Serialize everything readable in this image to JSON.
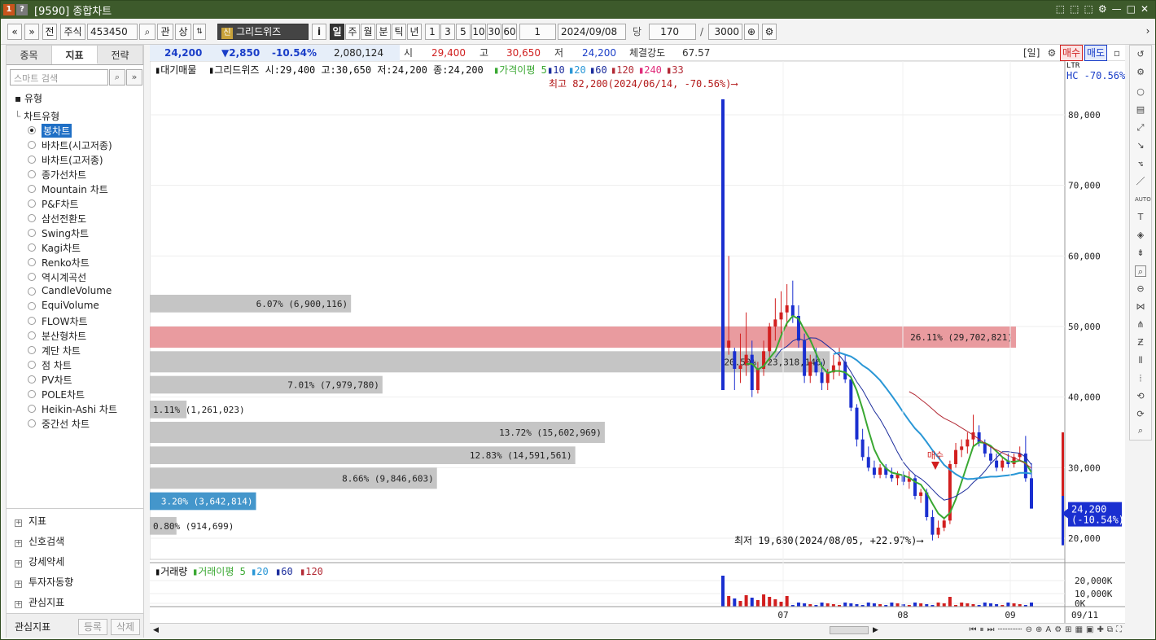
{
  "window": {
    "badge1": "1",
    "badge2": "?",
    "title": "[9590] 종합차트",
    "controls": [
      "⬚",
      "⬚",
      "⬚",
      "⚙",
      "—",
      "□",
      "✕"
    ]
  },
  "toolbar": {
    "prev": "«",
    "down": "»",
    "jeon": "전",
    "market": "주식",
    "code": "453450",
    "kwan": "관",
    "sang": "상",
    "name": "그리드위즈",
    "name_badge": "신",
    "info": "i",
    "periods": [
      "일",
      "주",
      "월",
      "분",
      "틱",
      "년"
    ],
    "mins": [
      "1",
      "3",
      "5",
      "10",
      "30",
      "60"
    ],
    "interval": "1",
    "date": "2024/09/08",
    "dang": "당",
    "count": "170",
    "slash": "/",
    "total": "3000"
  },
  "left": {
    "tabs": [
      "종목",
      "지표",
      "전략"
    ],
    "search_placeholder": "스마트 검색",
    "group": "유형",
    "subgroup": "차트유형",
    "types": [
      "봉차트",
      "바차트(시고저종)",
      "바차트(고저종)",
      "종가선차트",
      "Mountain 차트",
      "P&F차트",
      "삼선전환도",
      "Swing차트",
      "Kagi차트",
      "Renko차트",
      "역시계곡선",
      "CandleVolume",
      "EquiVolume",
      "FLOW차트",
      "분산형차트",
      "계단 차트",
      "점 차트",
      "PV차트",
      "POLE차트",
      "Heikin-Ashi 차트",
      "중간선 차트"
    ],
    "selected": "봉차트",
    "categories": [
      "지표",
      "신호검색",
      "강세약세",
      "투자자동향",
      "관심지표"
    ],
    "fav": "관심지표",
    "btn_reg": "등록",
    "btn_del": "삭제"
  },
  "quote": {
    "price": "24,200",
    "change": "▼2,850",
    "rate": "-10.54%",
    "volume": "2,080,124",
    "open_l": "시",
    "open": "29,400",
    "high_l": "고",
    "high": "30,650",
    "low_l": "저",
    "low": "24,200",
    "strength_l": "체결강도",
    "strength": "67.57",
    "period": "[일]",
    "buy": "매수",
    "sell": "매도"
  },
  "chart_header": {
    "vp": "대기매물",
    "name": "그리드위즈",
    "ohlc": "시:29,400 고:30,650 저:24,200 종:24,200",
    "ma_label": "가격이평",
    "ma": [
      "5",
      "10",
      "20",
      "60",
      "120",
      "240",
      "33"
    ]
  },
  "price_axis": {
    "hc": "HC -70.56%",
    "ticks": [
      "80,000",
      "70,000",
      "60,000",
      "50,000",
      "40,000",
      "30,000",
      "20,000"
    ],
    "current": "24,200",
    "current_rate": "(-10.54%)",
    "ltr": "LTR"
  },
  "annotations": {
    "high": "최고 82,200(2024/06/14, -70.56%)",
    "low": "최저 19,680(2024/08/05, +22.97%)",
    "buy": "매수"
  },
  "volume": {
    "label": "거래량",
    "ma_label": "거래이평",
    "ma": [
      "5",
      "20",
      "60",
      "120"
    ],
    "ticks": [
      "20,000K",
      "10,000K",
      "0K"
    ]
  },
  "xaxis": {
    "labels": [
      "07",
      "08",
      "09"
    ],
    "last": "09/11"
  },
  "chart_data": {
    "type": "bar",
    "title": "대기매물",
    "categories": [
      "6.07%",
      "26.11%",
      "20.50%",
      "7.01%",
      "1.11%",
      "13.72%",
      "12.83%",
      "8.66%",
      "3.20%",
      "0.80%"
    ],
    "labels": [
      "6.07% (6,900,116)",
      "26.11% (29,702,821)",
      "20.50% (23,318,146)",
      "7.01% (7,979,780)",
      "1.11% (1,261,023)",
      "13.72% (15,602,969)",
      "12.83% (14,591,561)",
      "8.66% (9,846,603)",
      "3.20% (3,642,814)",
      "0.80% (914,699)"
    ],
    "values": [
      6900116,
      29702821,
      23318146,
      7979780,
      1261023,
      15602969,
      14591561,
      9846603,
      3642814,
      914699
    ],
    "price_bands": [
      [
        52000,
        54500
      ],
      [
        47000,
        50000
      ],
      [
        43500,
        46500
      ],
      [
        40500,
        43000
      ],
      [
        37000,
        39500
      ],
      [
        33500,
        36500
      ],
      [
        30500,
        33000
      ],
      [
        27000,
        30000
      ],
      [
        24000,
        26500
      ],
      [
        20500,
        23000
      ]
    ],
    "ylim": [
      17000,
      86000
    ],
    "candles": [
      [
        82200,
        82200,
        41000,
        41000
      ],
      [
        47000,
        60000,
        46000,
        48000
      ],
      [
        46500,
        47000,
        41000,
        44000
      ],
      [
        44000,
        49000,
        42000,
        44500
      ],
      [
        44500,
        52000,
        43000,
        46000
      ],
      [
        46000,
        48000,
        40000,
        41000
      ],
      [
        41000,
        45000,
        40500,
        44000
      ],
      [
        44000,
        48000,
        43000,
        46500
      ],
      [
        46500,
        50500,
        45000,
        50000
      ],
      [
        50000,
        54000,
        48000,
        51000
      ],
      [
        51000,
        55000,
        49000,
        52000
      ],
      [
        52000,
        56000,
        50000,
        53000
      ],
      [
        53000,
        56500,
        50500,
        51500
      ],
      [
        51500,
        53000,
        47000,
        48000
      ],
      [
        48000,
        49000,
        42000,
        43000
      ],
      [
        43000,
        46000,
        42000,
        45000
      ],
      [
        45000,
        47000,
        43000,
        43500
      ],
      [
        43500,
        45000,
        41000,
        42000
      ],
      [
        42000,
        44000,
        41000,
        43500
      ],
      [
        43500,
        46000,
        42500,
        44500
      ],
      [
        44500,
        47000,
        43000,
        45000
      ],
      [
        45000,
        46000,
        42000,
        42500
      ],
      [
        42500,
        43000,
        38000,
        38500
      ],
      [
        38500,
        39000,
        33000,
        34000
      ],
      [
        34000,
        35500,
        31000,
        31500
      ],
      [
        31500,
        33000,
        29500,
        30000
      ],
      [
        30000,
        31000,
        28500,
        29000
      ],
      [
        29000,
        30500,
        28500,
        30000
      ],
      [
        30000,
        30500,
        28500,
        29000
      ],
      [
        29000,
        30000,
        28000,
        28500
      ],
      [
        28500,
        29500,
        27500,
        29000
      ],
      [
        29000,
        29500,
        27500,
        28000
      ],
      [
        28000,
        29500,
        27000,
        28500
      ],
      [
        28500,
        29000,
        25500,
        26000
      ],
      [
        26000,
        27000,
        25000,
        26500
      ],
      [
        26500,
        27000,
        22500,
        23000
      ],
      [
        23000,
        24000,
        19680,
        20500
      ],
      [
        20500,
        22500,
        20000,
        21500
      ],
      [
        21500,
        23000,
        21000,
        22500
      ],
      [
        22500,
        31000,
        22000,
        30500
      ],
      [
        30500,
        33500,
        30000,
        32500
      ],
      [
        32500,
        34000,
        31500,
        33000
      ],
      [
        33000,
        35000,
        32000,
        34000
      ],
      [
        34000,
        37500,
        33000,
        35000
      ],
      [
        35000,
        36000,
        33000,
        33500
      ],
      [
        33500,
        34000,
        31500,
        32000
      ],
      [
        32000,
        33000,
        30500,
        31000
      ],
      [
        31000,
        32000,
        29500,
        30000
      ],
      [
        30000,
        31500,
        29500,
        31000
      ],
      [
        31000,
        32000,
        30000,
        30500
      ],
      [
        30500,
        32000,
        30000,
        31500
      ],
      [
        31500,
        33000,
        31000,
        32000
      ],
      [
        32000,
        34500,
        28000,
        28500
      ],
      [
        28500,
        30650,
        24200,
        24200
      ]
    ]
  }
}
